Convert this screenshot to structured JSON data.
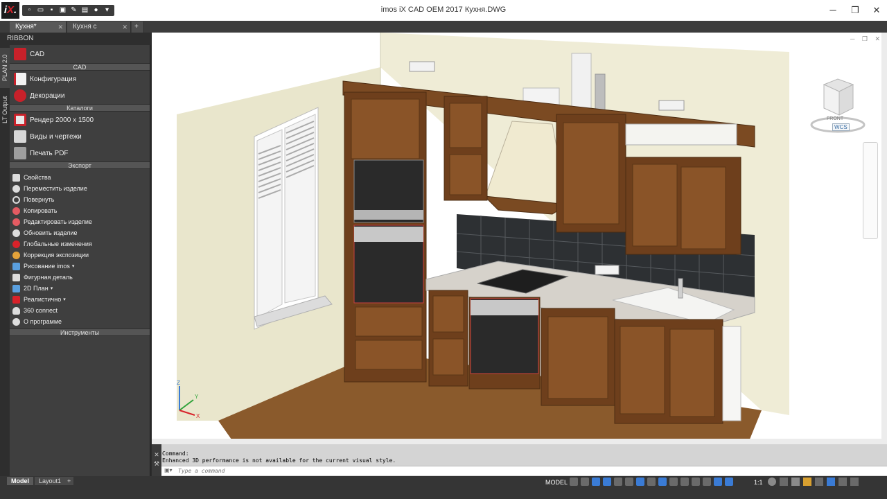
{
  "window": {
    "title": "imos iX CAD OEM 2017   Кухня.DWG",
    "logo_text": "iX.",
    "min_glyph": "─",
    "max_glyph": "❐",
    "close_glyph": "✕"
  },
  "doc_tabs": [
    {
      "label": "Кухня*",
      "close": "✕"
    },
    {
      "label": "Кухня с трубами*",
      "close": "✕"
    }
  ],
  "doc_tab_add": "+",
  "side_tabs": [
    "PLAN 2.0",
    "LT Output"
  ],
  "ribbon": {
    "title": "RIBBON",
    "cad_label": "CAD",
    "sections": {
      "cad": "CAD",
      "catalogs": "Каталоги",
      "export": "Экспорт",
      "tools": "Инструменты"
    },
    "cad_items": [
      "Конфигурация",
      "Декорации"
    ],
    "catalog_items": [
      "Рендер 2000 x 1500",
      "Виды и чертежи",
      "Печать PDF"
    ],
    "export_items": [
      "Свойства",
      "Переместить изделие",
      "Повернуть",
      "Копировать",
      "Редактировать изделие",
      "Обновить изделие",
      "Глобальные изменения",
      "Коррекция экспозиции",
      "Рисование imos",
      "Фигурная деталь",
      "2D План",
      "Реалистично",
      "360 connect",
      "О программе"
    ]
  },
  "viewport": {
    "viewcube_face": "FRONT",
    "wcs_label": "WCS",
    "axis_y": "Y",
    "axis_x": "X",
    "axis_z": "Z"
  },
  "command": {
    "line1": "Command:",
    "line2": "Enhanced 3D performance is not available for the current visual style.",
    "placeholder": "Type a command"
  },
  "layout_tabs": [
    "Model",
    "Layout1"
  ],
  "layout_add": "+",
  "status": {
    "model": "MODEL",
    "scale": "1:1"
  },
  "colors": {
    "wood": "#6e3f1c",
    "wood_light": "#8a5428",
    "tile": "#2d3033",
    "wall": "#efecd6",
    "floor": "#8a5a2c",
    "counter": "#d6d2cb"
  }
}
